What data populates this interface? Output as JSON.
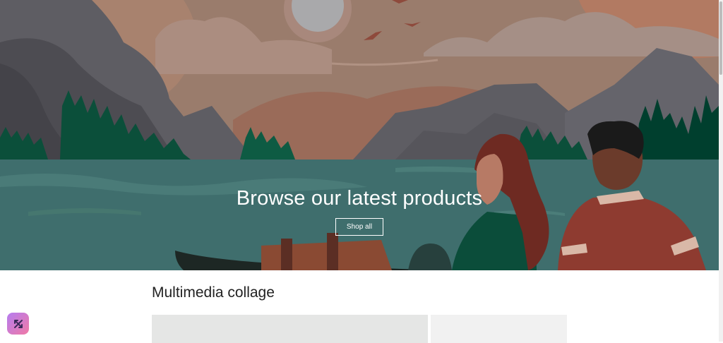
{
  "hero": {
    "title": "Browse our latest products",
    "button_label": "Shop all"
  },
  "collage": {
    "title": "Multimedia collage"
  },
  "floating_app": {
    "icon": "app-launcher-icon"
  },
  "colors": {
    "sky": "#9a7c6c",
    "lake": "#3f6e6d",
    "mountain": "#65646b",
    "forest": "#00513b",
    "placeholder_large": "#e5e6e5",
    "placeholder_small": "#f1f1f1",
    "app_gradient_start": "#b57cf0",
    "app_gradient_end": "#f07aa5"
  }
}
